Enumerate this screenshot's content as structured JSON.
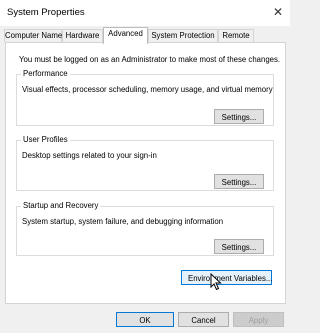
{
  "window": {
    "title": "System Properties",
    "close_glyph": "✕"
  },
  "tabs": [
    {
      "label": "Computer Name",
      "active": false
    },
    {
      "label": "Hardware",
      "active": false
    },
    {
      "label": "Advanced",
      "active": true
    },
    {
      "label": "System Protection",
      "active": false
    },
    {
      "label": "Remote",
      "active": false
    }
  ],
  "notice": "You must be logged on as an Administrator to make most of these changes.",
  "groups": {
    "performance": {
      "title": "Performance",
      "description": "Visual effects, processor scheduling, memory usage, and virtual memory",
      "button": "Settings..."
    },
    "user_profiles": {
      "title": "User Profiles",
      "description": "Desktop settings related to your sign-in",
      "button": "Settings..."
    },
    "startup_recovery": {
      "title": "Startup and Recovery",
      "description": "System startup, system failure, and debugging information",
      "button": "Settings..."
    }
  },
  "env_button": "Environment Variables...",
  "footer": {
    "ok": "OK",
    "cancel": "Cancel",
    "apply": "Apply"
  },
  "colors": {
    "accent": "#0078d7",
    "dialog_bg": "#f0f0f0",
    "panel_bg": "#ffffff"
  },
  "icons": {
    "close": "close-icon",
    "cursor": "mouse-pointer-icon"
  }
}
